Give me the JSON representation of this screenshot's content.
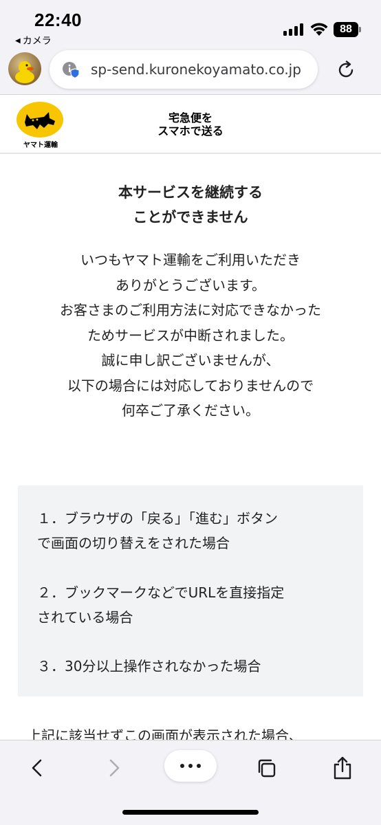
{
  "status_bar": {
    "time": "22:40",
    "back_app": "カメラ",
    "battery": "88"
  },
  "browser": {
    "url": "sp-send.kuronekoyamato.co.jp"
  },
  "site_header": {
    "logo_text": "ヤマト運輸",
    "service_title_line1": "宅急便を",
    "service_title_line2": "スマホで送る"
  },
  "content": {
    "heading_line1": "本サービスを継続する",
    "heading_line2": "ことができません",
    "message_lines": [
      "いつもヤマト運輸をご利用いただき",
      "ありがとうございます。",
      "お客さまのご利用方法に対応できなかった",
      "ためサービスが中断されました。",
      "誠に申し訳ございませんが、",
      "以下の場合には対応しておりませんので",
      "何卒ご了承ください。"
    ],
    "reasons": [
      {
        "line1": "１．ブラウザの「戻る」「進む」ボタン",
        "line2": "で画面の切り替えをされた場合"
      },
      {
        "line1": "２．ブックマークなどでURLを直接指定",
        "line2": "されている場合"
      },
      {
        "line1": "３．30分以上操作されなかった場合",
        "line2": ""
      }
    ],
    "footer_note": "上記に該当せずこの画面が表示された場合、"
  },
  "colors": {
    "logo_yellow": "#f7c600",
    "reasons_bg": "#f2f3f5",
    "chrome_bg": "#f2f2f7",
    "shield_blue": "#2f6fe0"
  },
  "icons": {
    "site_info": "site-info-shield-icon",
    "reload": "reload-icon",
    "back": "chevron-left-icon",
    "forward": "chevron-right-icon",
    "more": "more-dots-icon",
    "tabs": "tabs-icon",
    "share": "share-icon"
  }
}
